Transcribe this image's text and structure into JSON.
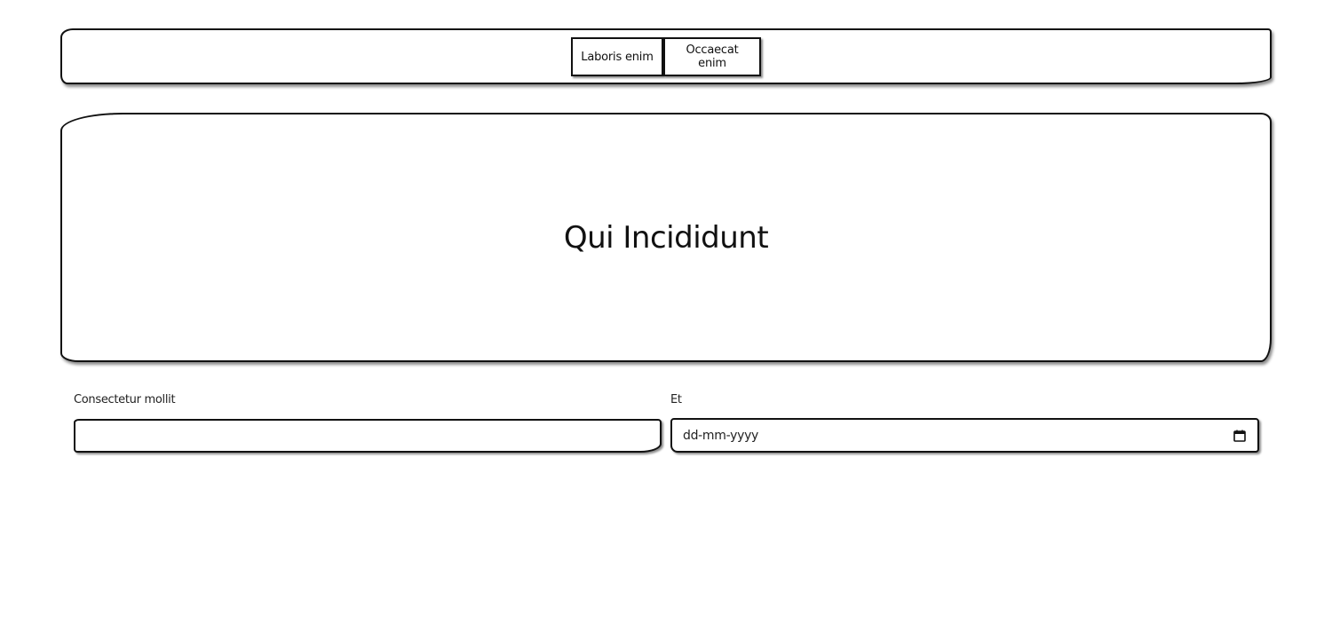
{
  "nav": {
    "buttons": [
      {
        "label": "Laboris enim"
      },
      {
        "label": "Occaecat enim"
      }
    ]
  },
  "hero": {
    "title": "Qui Incididunt"
  },
  "form": {
    "fields": [
      {
        "label": "Consectetur mollit",
        "value": "",
        "type": "text"
      },
      {
        "label": "Et",
        "placeholder": "dd-mm-yyyy",
        "type": "date",
        "icon": "calendar-icon"
      }
    ]
  },
  "colors": {
    "border": "#111111",
    "background": "#ffffff",
    "text": "#111111"
  }
}
